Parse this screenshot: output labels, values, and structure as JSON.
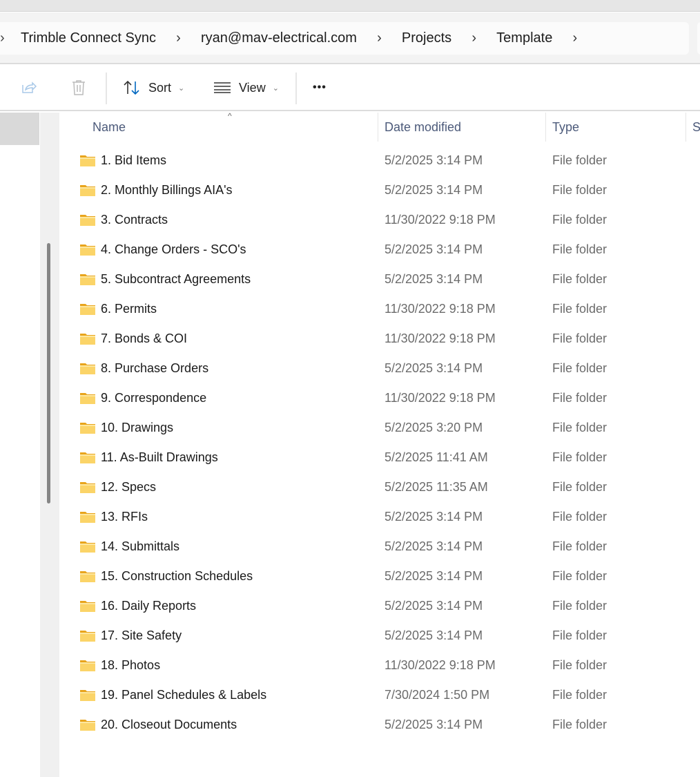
{
  "breadcrumb": [
    "Trimble Connect Sync",
    "ryan@mav-electrical.com",
    "Projects",
    "Template"
  ],
  "toolbar": {
    "sort_label": "Sort",
    "view_label": "View",
    "more_label": "•••"
  },
  "columns": {
    "name": "Name",
    "date": "Date modified",
    "type": "Type",
    "size": "S"
  },
  "files": [
    {
      "name": "1. Bid Items",
      "date": "5/2/2025 3:14 PM",
      "type": "File folder"
    },
    {
      "name": "2. Monthly Billings AIA's",
      "date": "5/2/2025 3:14 PM",
      "type": "File folder"
    },
    {
      "name": "3. Contracts",
      "date": "11/30/2022 9:18 PM",
      "type": "File folder"
    },
    {
      "name": "4. Change Orders - SCO's",
      "date": "5/2/2025 3:14 PM",
      "type": "File folder"
    },
    {
      "name": "5. Subcontract Agreements",
      "date": "5/2/2025 3:14 PM",
      "type": "File folder"
    },
    {
      "name": "6. Permits",
      "date": "11/30/2022 9:18 PM",
      "type": "File folder"
    },
    {
      "name": "7. Bonds & COI",
      "date": "11/30/2022 9:18 PM",
      "type": "File folder"
    },
    {
      "name": "8. Purchase Orders",
      "date": "5/2/2025 3:14 PM",
      "type": "File folder"
    },
    {
      "name": "9. Correspondence",
      "date": "11/30/2022 9:18 PM",
      "type": "File folder"
    },
    {
      "name": "10. Drawings",
      "date": "5/2/2025 3:20 PM",
      "type": "File folder"
    },
    {
      "name": "11. As-Built Drawings",
      "date": "5/2/2025 11:41 AM",
      "type": "File folder"
    },
    {
      "name": "12. Specs",
      "date": "5/2/2025 11:35 AM",
      "type": "File folder"
    },
    {
      "name": "13. RFIs",
      "date": "5/2/2025 3:14 PM",
      "type": "File folder"
    },
    {
      "name": "14. Submittals",
      "date": "5/2/2025 3:14 PM",
      "type": "File folder"
    },
    {
      "name": "15. Construction Schedules",
      "date": "5/2/2025 3:14 PM",
      "type": "File folder"
    },
    {
      "name": "16. Daily Reports",
      "date": "5/2/2025 3:14 PM",
      "type": "File folder"
    },
    {
      "name": "17. Site Safety",
      "date": "5/2/2025 3:14 PM",
      "type": "File folder"
    },
    {
      "name": "18. Photos",
      "date": "11/30/2022 9:18 PM",
      "type": "File folder"
    },
    {
      "name": "19. Panel Schedules & Labels",
      "date": "7/30/2024 1:50 PM",
      "type": "File folder"
    },
    {
      "name": "20. Closeout Documents",
      "date": "5/2/2025 3:14 PM",
      "type": "File folder"
    }
  ],
  "colors": {
    "folder": "#f8c94a",
    "header_text": "#4c5a7a",
    "accent": "#0067c0"
  }
}
